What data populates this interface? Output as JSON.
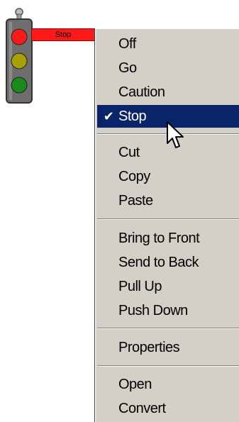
{
  "widget": {
    "label": "Stop",
    "colors": {
      "red": "#ff1a1a",
      "yellow": "#a8a000",
      "green": "#1a8a1a",
      "housing": "#6e6e6e"
    }
  },
  "menu": {
    "items": [
      {
        "label": "Off"
      },
      {
        "label": "Go"
      },
      {
        "label": "Caution"
      },
      {
        "label": "Stop",
        "checked": true,
        "selected": true
      },
      {
        "label": "Cut"
      },
      {
        "label": "Copy"
      },
      {
        "label": "Paste"
      },
      {
        "label": "Bring to Front"
      },
      {
        "label": "Send to Back"
      },
      {
        "label": "Pull Up"
      },
      {
        "label": "Push Down"
      },
      {
        "label": "Properties"
      },
      {
        "label": "Open"
      },
      {
        "label": "Convert"
      }
    ],
    "check_glyph": "✔",
    "selection_color": "#0a246a",
    "background_color": "#d4d0c8"
  }
}
